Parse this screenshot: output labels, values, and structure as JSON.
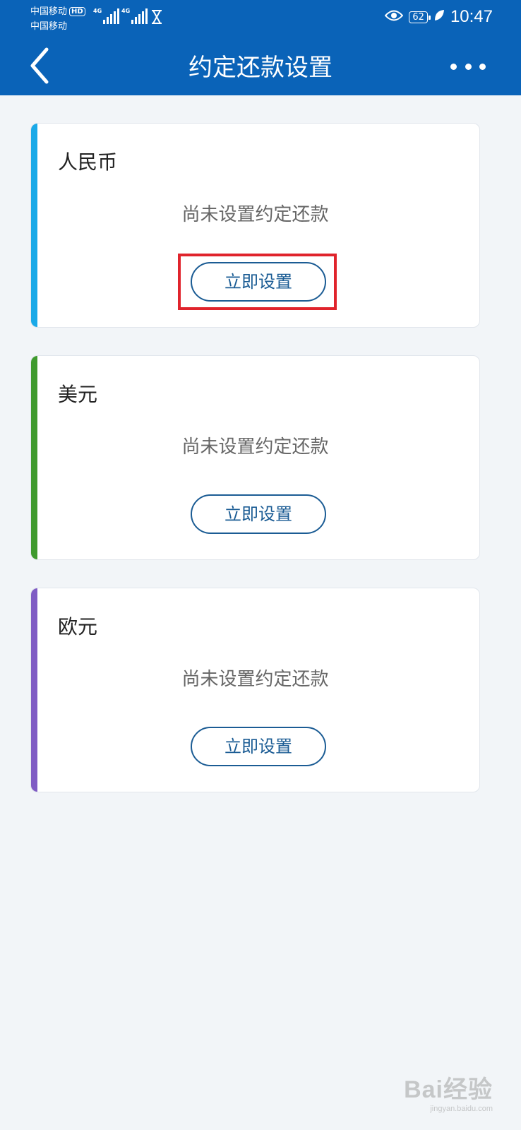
{
  "status_bar": {
    "carrier_1": "中国移动",
    "carrier_2": "中国移动",
    "hd_badge": "HD",
    "network_1": "4G",
    "network_2": "4G",
    "battery_level": "62",
    "time": "10:47"
  },
  "header": {
    "title": "约定还款设置",
    "back_icon": "chevron-left-icon",
    "more_icon": "more-dots-icon"
  },
  "cards": [
    {
      "currency": "人民币",
      "status": "尚未设置约定还款",
      "button_label": "立即设置",
      "accent_color": "#1aa9e8"
    },
    {
      "currency": "美元",
      "status": "尚未设置约定还款",
      "button_label": "立即设置",
      "accent_color": "#3f9a2e"
    },
    {
      "currency": "欧元",
      "status": "尚未设置约定还款",
      "button_label": "立即设置",
      "accent_color": "#7f5cc4"
    }
  ],
  "colors": {
    "header_bg": "#0a63b8",
    "page_bg": "#f2f5f8",
    "button_border": "#1b5c94",
    "highlight": "#e0242c"
  },
  "watermark": {
    "main": "Bai经验",
    "sub": "jingyan.baidu.com"
  }
}
